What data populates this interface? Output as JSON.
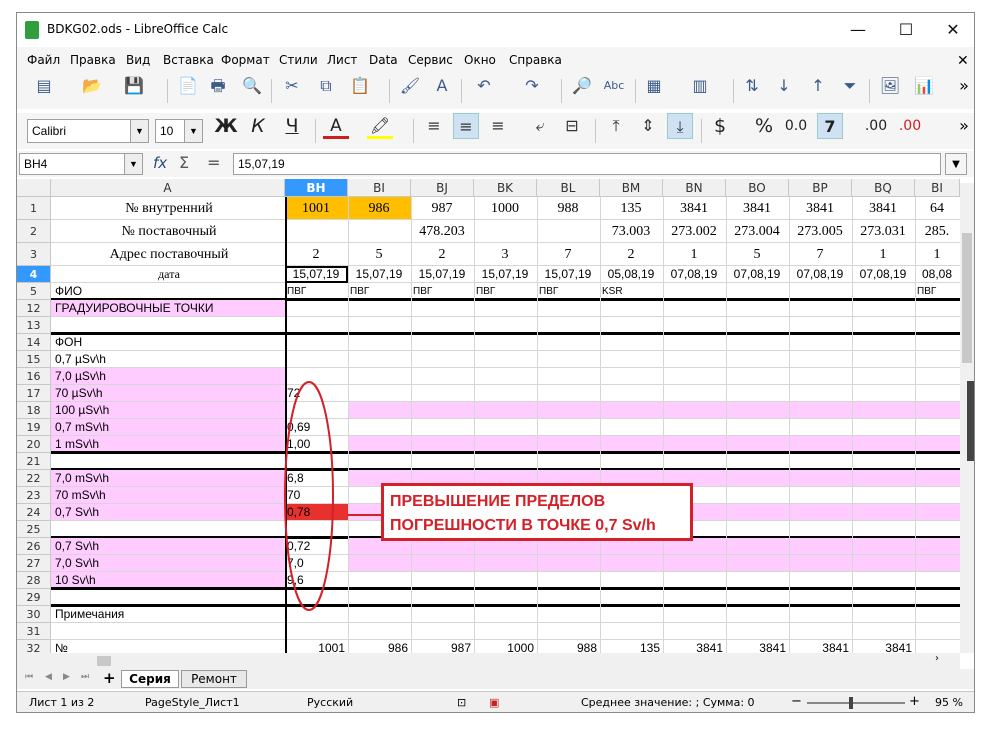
{
  "window": {
    "title": "BDKG02.ods - LibreOffice Calc",
    "minimize": "—",
    "maximize": "☐",
    "close": "✕"
  },
  "menu": [
    "Файл",
    "Правка",
    "Вид",
    "Вставка",
    "Формат",
    "Стили",
    "Лист",
    "Data",
    "Сервис",
    "Окно",
    "Справка"
  ],
  "format_toolbar": {
    "font_name": "Calibri",
    "font_size": "10",
    "bold": "Ж",
    "italic": "К",
    "underline": "Ч",
    "font_color": "A",
    "currency": "$",
    "percent": "%",
    "decimal": "0.0",
    "add_decimal": ".00",
    "del_decimal": ".00"
  },
  "formula_bar": {
    "name_box": "BH4",
    "fx": "fx",
    "sum": "Σ",
    "equals": "=",
    "content": "15,07,19"
  },
  "columns": [
    "A",
    "BH",
    "BI",
    "BJ",
    "BK",
    "BL",
    "BM",
    "BN",
    "BO",
    "BP",
    "BQ",
    "BI"
  ],
  "rows": [
    {
      "n": "1",
      "a": "№ внутренний",
      "v": [
        "1001",
        "986",
        "987",
        "1000",
        "988",
        "135",
        "3841",
        "3841",
        "3841",
        "3841",
        "64"
      ]
    },
    {
      "n": "2",
      "a": "№ поставочный",
      "v": [
        "",
        "",
        "478.203",
        "",
        "",
        "73.003",
        "273.002",
        "273.004",
        "273.005",
        "273.031",
        "285."
      ]
    },
    {
      "n": "3",
      "a": "Адрес поставочный",
      "v": [
        "2",
        "5",
        "2",
        "3",
        "7",
        "2",
        "1",
        "5",
        "7",
        "1",
        "1"
      ]
    },
    {
      "n": "4",
      "a": "дата",
      "v": [
        "15,07,19",
        "15,07,19",
        "15,07,19",
        "15,07,19",
        "15,07,19",
        "05,08,19",
        "07,08,19",
        "07,08,19",
        "07,08,19",
        "07,08,19",
        "08,08"
      ]
    },
    {
      "n": "5",
      "a": "ФИО",
      "v": [
        "ПВГ",
        "ПВГ",
        "ПВГ",
        "ПВГ",
        "ПВГ",
        "KSR",
        "",
        "",
        "",
        "",
        "ПВГ"
      ]
    },
    {
      "n": "12",
      "a": "ГРАДУИРОВОЧНЫЕ ТОЧКИ",
      "v": []
    },
    {
      "n": "13",
      "a": "",
      "v": []
    },
    {
      "n": "14",
      "a": "ФОН",
      "v": []
    },
    {
      "n": "15",
      "a": "0,7  µSv\\h",
      "v": []
    },
    {
      "n": "16",
      "a": "7,0  µSv\\h",
      "v": []
    },
    {
      "n": "17",
      "a": "70 µSv\\h",
      "v": [
        "72"
      ]
    },
    {
      "n": "18",
      "a": "100 µSv\\h",
      "v": []
    },
    {
      "n": "19",
      "a": "0,7 mSv\\h",
      "v": [
        "0,69"
      ]
    },
    {
      "n": "20",
      "a": "1 mSv\\h",
      "v": [
        "1,00"
      ]
    },
    {
      "n": "21",
      "a": "",
      "v": []
    },
    {
      "n": "22",
      "a": "7,0 mSv\\h",
      "v": [
        "6,8"
      ]
    },
    {
      "n": "23",
      "a": "70  mSv\\h",
      "v": [
        "70"
      ]
    },
    {
      "n": "24",
      "a": "0,7  Sv\\h",
      "v": [
        "0,78"
      ]
    },
    {
      "n": "25",
      "a": "",
      "v": []
    },
    {
      "n": "26",
      "a": "0,7 Sv\\h",
      "v": [
        "0,72"
      ]
    },
    {
      "n": "27",
      "a": "7,0   Sv\\h",
      "v": [
        "7,0"
      ]
    },
    {
      "n": "28",
      "a": "10 Sv\\h",
      "v": [
        "9,6"
      ]
    },
    {
      "n": "29",
      "a": "",
      "v": []
    },
    {
      "n": "30",
      "a": "Примечания",
      "v": []
    },
    {
      "n": "31",
      "a": "",
      "v": []
    },
    {
      "n": "32",
      "a": "№",
      "v": [
        "1001",
        "986",
        "987",
        "1000",
        "988",
        "135",
        "3841",
        "3841",
        "3841",
        "3841"
      ]
    }
  ],
  "callout": {
    "line1": "ПРЕВЫШЕНИЕ ПРЕДЕЛОВ",
    "line2": "ПОГРЕШНОСТИ В ТОЧКЕ 0,7 Sv/h"
  },
  "sheet_tabs": {
    "add": "+",
    "tabs": [
      "Серия",
      "Ремонт"
    ]
  },
  "status": {
    "sheet": "Лист 1 из 2",
    "page_style": "PageStyle_Лист1",
    "language": "Русский",
    "summary": "Среднее значение: ; Сумма: 0",
    "zoom_minus": "−",
    "zoom_plus": "+",
    "zoom": "95 %"
  },
  "colors": {
    "pink": "#ffccff",
    "yellow": "#ffbf00",
    "selected_header": "#3399ff",
    "alert_red": "#e8312f",
    "annotation": "#d42027"
  }
}
